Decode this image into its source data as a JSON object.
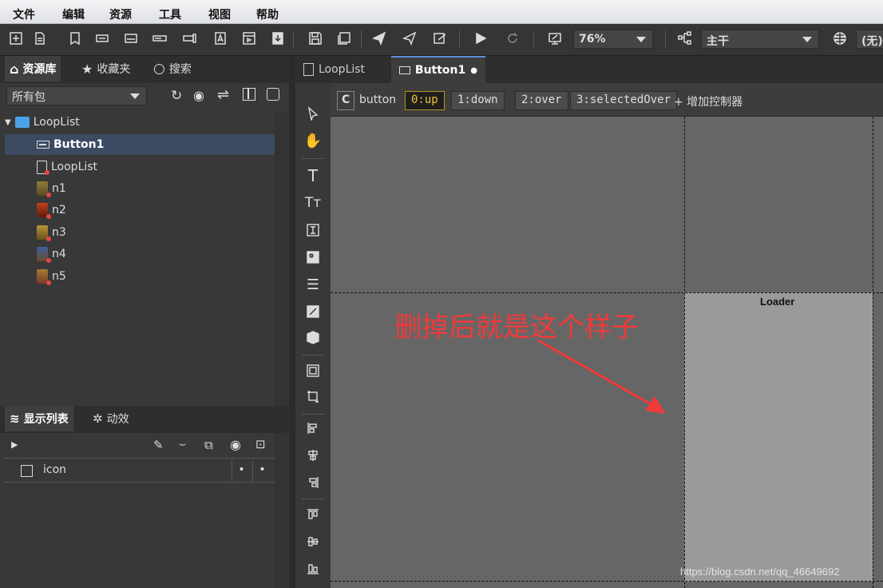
{
  "menu": [
    "文件",
    "编辑",
    "资源",
    "工具",
    "视图",
    "帮助"
  ],
  "toolbar": {
    "zoom_value": "76%",
    "branch_value": "主干",
    "language_value": "(无)"
  },
  "library": {
    "tabs": [
      "资源库",
      "收藏夹",
      "搜索"
    ],
    "package_select": "所有包",
    "tree": {
      "root": "LoopList",
      "children": [
        "Button1",
        "LoopList",
        "n1",
        "n2",
        "n3",
        "n4",
        "n5"
      ]
    }
  },
  "display_list": {
    "tabs": [
      "显示列表",
      "动效"
    ],
    "items": [
      {
        "name": "icon",
        "col1": "•",
        "col2": "•"
      }
    ]
  },
  "editor": {
    "tabs": [
      "LoopList",
      "Button1"
    ],
    "modified_dot": "●",
    "controller_letter": "C",
    "controller_name": "button",
    "pages": [
      "0:up",
      "1:down",
      "2:over",
      "3:selectedOver"
    ],
    "selected_page": "0:up",
    "add_controller": "+ 增加控制器"
  },
  "canvas": {
    "loader_label": "Loader",
    "annotation": "删掉后就是这个样子",
    "watermark": "https://blog.csdn.net/qq_46649692"
  },
  "colors": {
    "accent": "#5a8fd8",
    "selected_row": "#3c4a62",
    "annotation_red": "#f03a3a",
    "selected_page": "#f2c230"
  }
}
